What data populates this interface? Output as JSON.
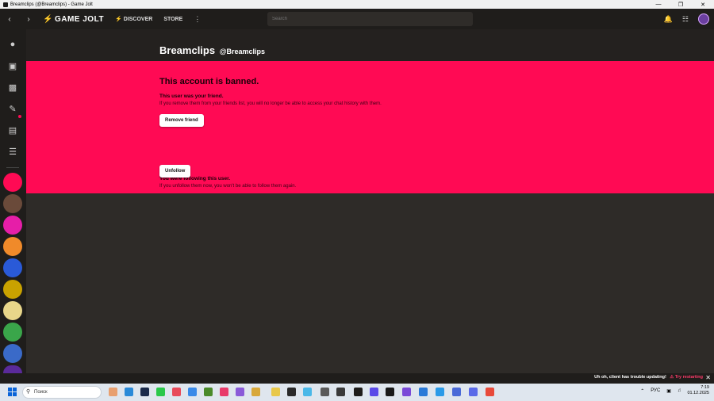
{
  "window": {
    "title": "Breamclips (@Breamclips) - Game Jolt"
  },
  "nav": {
    "logo": "GAME JOLT",
    "discover": "DISCOVER",
    "store": "STORE",
    "search_placeholder": "Search"
  },
  "profile": {
    "name": "Breamclips",
    "handle": "@Breamclips"
  },
  "banned": {
    "title": "This account is banned.",
    "friend_heading": "This user was your friend.",
    "friend_text": "If you remove them from your friends list, you will no longer be able to access your chat history with them.",
    "remove_friend_label": "Remove friend",
    "follow_heading": "You were following this user.",
    "follow_text": "If you unfollow them now, you won't be able to follow them again.",
    "unfollow_label": "Unfollow"
  },
  "notice": {
    "message": "Uh oh, client has trouble updating!",
    "action": "Try restarting"
  },
  "taskbar": {
    "search": "Поиск",
    "lang": "РУС",
    "time": "7:19",
    "date": "01.12.2025"
  },
  "colors": {
    "banned_bg": "#ff0a54",
    "accent": "#ccff00"
  }
}
